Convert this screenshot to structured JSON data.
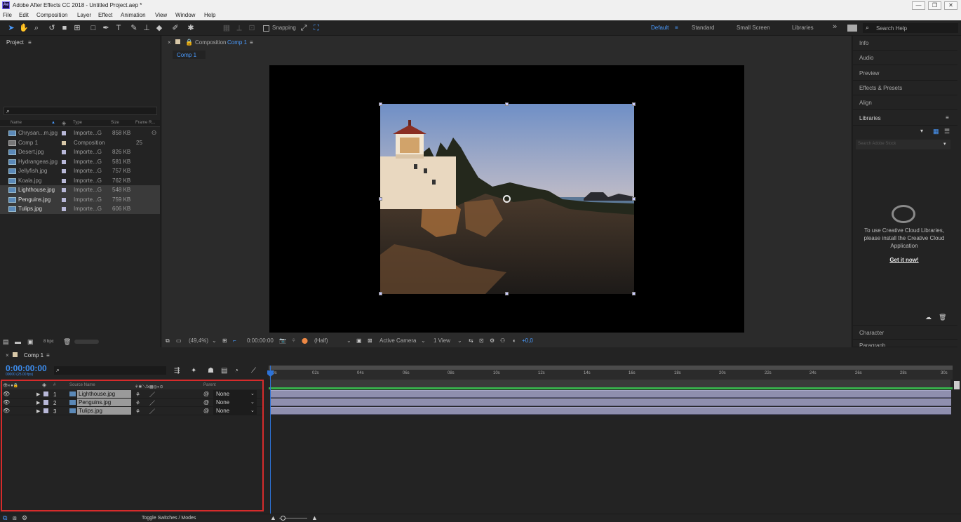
{
  "window": {
    "title": "Adobe After Effects CC 2018 - Untitled Project.aep *",
    "app_icon": "Ae",
    "minimize": "—",
    "restore": "❐",
    "close": "✕"
  },
  "menu": [
    "File",
    "Edit",
    "Composition",
    "Layer",
    "Effect",
    "Animation",
    "View",
    "Window",
    "Help"
  ],
  "toolbar": {
    "snapping": "Snapping",
    "workspaces": [
      "Default",
      "Standard",
      "Small Screen",
      "Libraries"
    ],
    "more": "»",
    "search_placeholder": "Search Help"
  },
  "project": {
    "title": "Project",
    "menu_icon": "≡",
    "columns": [
      "Name",
      "Type",
      "Size",
      "Frame R..."
    ],
    "items": [
      {
        "name": "Chrysan...m.jpg",
        "type": "Importe...G",
        "size": "858 KB",
        "frame": ""
      },
      {
        "name": "Comp 1",
        "type": "Composition",
        "size": "",
        "frame": "25"
      },
      {
        "name": "Desert.jpg",
        "type": "Importe...G",
        "size": "826 KB",
        "frame": ""
      },
      {
        "name": "Hydrangeas.jpg",
        "type": "Importe...G",
        "size": "581 KB",
        "frame": ""
      },
      {
        "name": "Jellyfish.jpg",
        "type": "Importe...G",
        "size": "757 KB",
        "frame": ""
      },
      {
        "name": "Koala.jpg",
        "type": "Importe...G",
        "size": "762 KB",
        "frame": ""
      },
      {
        "name": "Lighthouse.jpg",
        "type": "Importe...G",
        "size": "548 KB",
        "frame": ""
      },
      {
        "name": "Penguins.jpg",
        "type": "Importe...G",
        "size": "759 KB",
        "frame": ""
      },
      {
        "name": "Tulips.jpg",
        "type": "Importe...G",
        "size": "606 KB",
        "frame": ""
      }
    ],
    "bpc": "8 bpc"
  },
  "composition": {
    "panel_prefix": "Composition",
    "comp_name": "Comp 1",
    "tab": "Comp 1",
    "zoom": "(49,4%)",
    "timecode": "0:00:00:00",
    "resolution": "(Half)",
    "camera": "Active Camera",
    "views": "1 View",
    "exposure": "+0,0"
  },
  "right_panel": {
    "items": [
      "Info",
      "Audio",
      "Preview",
      "Effects & Presets",
      "Align",
      "Libraries"
    ],
    "stock_placeholder": "Search Adobe Stock",
    "cc_message": "To use Creative Cloud Libraries, please install the Creative Cloud Application",
    "get_it": "Get it now!",
    "character": "Character",
    "paragraph": "Paragraph"
  },
  "timeline": {
    "tab": "Comp 1",
    "timecode": "0:00:00:00",
    "sub_timecode": "00000 (25.00 fps)",
    "col_source": "Source Name",
    "col_parent": "Parent",
    "col_num": "#",
    "layers": [
      {
        "num": "1",
        "name": "Lighthouse.jpg",
        "parent": "None"
      },
      {
        "num": "2",
        "name": "Penguins.jpg",
        "parent": "None"
      },
      {
        "num": "3",
        "name": "Tulips.jpg",
        "parent": "None"
      }
    ],
    "ticks": [
      "00s",
      "02s",
      "04s",
      "06s",
      "08s",
      "10s",
      "12s",
      "14s",
      "16s",
      "18s",
      "20s",
      "22s",
      "24s",
      "26s",
      "28s",
      "30s"
    ],
    "toggle": "Toggle Switches / Modes"
  }
}
